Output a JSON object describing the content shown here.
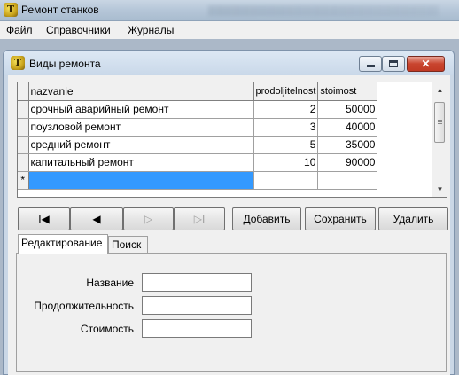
{
  "app": {
    "title": "Ремонт станков",
    "icon": "app-logo-icon"
  },
  "menu": [
    "Файл",
    "Справочники",
    "Журналы"
  ],
  "child_window": {
    "title": "Виды ремонта",
    "icon": "app-logo-icon"
  },
  "grid": {
    "columns": [
      "nazvanie",
      "prodoljitelnost",
      "stoimost"
    ],
    "rows": [
      [
        "срочный аварийный ремонт",
        "2",
        "50000"
      ],
      [
        "поузловой ремонт",
        "3",
        "40000"
      ],
      [
        "средний ремонт",
        "5",
        "35000"
      ],
      [
        "капитальный ремонт",
        "10",
        "90000"
      ]
    ],
    "new_row_marker": "*"
  },
  "navigator": {
    "first": "I◀",
    "prior": "◀",
    "next": "▷",
    "last": "▷I",
    "add": "Добавить",
    "save": "Сохранить",
    "delete": "Удалить"
  },
  "tabs": [
    {
      "label": "Редактирование",
      "active": true
    },
    {
      "label": "Поиск",
      "active": false
    }
  ],
  "form": {
    "name_label": "Название",
    "duration_label": "Продолжительность",
    "cost_label": "Стоимость",
    "name_value": "",
    "duration_value": "",
    "cost_value": ""
  }
}
